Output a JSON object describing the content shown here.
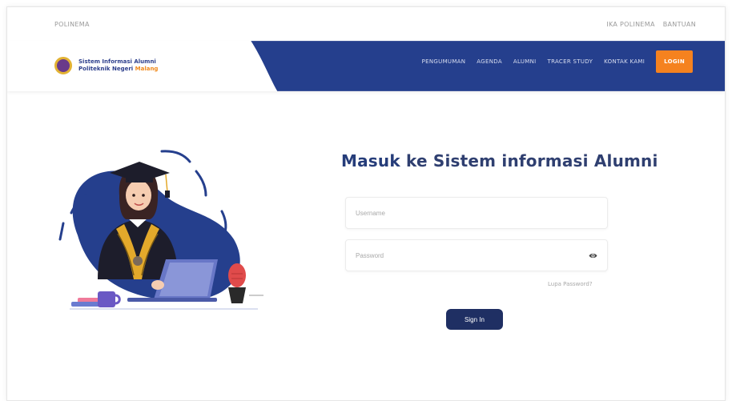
{
  "topbar": {
    "brand": "POLINEMA",
    "links": [
      "IKA POLINEMA",
      "BANTUAN"
    ]
  },
  "logo": {
    "line1": "Sistem Informasi Alumni",
    "line2_prefix": "Politeknik Negeri ",
    "line2_accent": "Malang"
  },
  "nav": {
    "items": [
      "PENGUMUMAN",
      "AGENDA",
      "ALUMNI",
      "TRACER STUDY",
      "KONTAK KAMI"
    ],
    "login": "LOGIN"
  },
  "login": {
    "title_strong": "Masuk",
    "title_rest": " ke Sistem informasi Alumni",
    "username_placeholder": "Username",
    "password_placeholder": "Password",
    "forgot": "Lupa Password?",
    "signin": "Sign In"
  },
  "colors": {
    "nav_blue": "#253f8d",
    "accent_orange": "#f5821f",
    "button_dark": "#1f2f63"
  }
}
